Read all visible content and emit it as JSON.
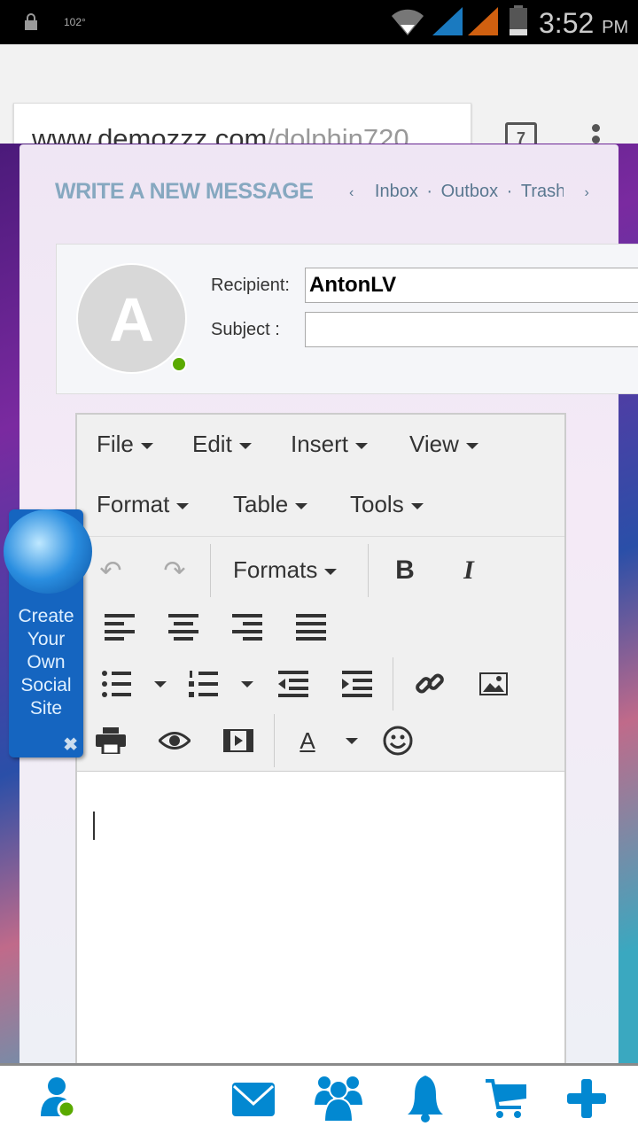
{
  "status_bar": {
    "temperature": "102°",
    "time": "3:52",
    "ampm": "PM",
    "icons": [
      "lock-icon",
      "wifi-icon",
      "signal-icon",
      "signal-icon",
      "battery-icon"
    ],
    "signal_colors": [
      "#1a7ac0",
      "#d06010"
    ]
  },
  "browser": {
    "url_host": "www.demozzz.com",
    "url_path": "/dolphin720",
    "tab_count": "7"
  },
  "page": {
    "title": "WRITE A NEW MESSAGE",
    "nav": {
      "prev": "‹",
      "next": "›",
      "links": [
        "Inbox",
        "Outbox",
        "Trash"
      ],
      "separator": "·"
    }
  },
  "compose": {
    "avatar_letter": "A",
    "recipient_label": "Recipient:",
    "recipient_value": "AntonLV",
    "subject_label": "Subject :",
    "subject_value": ""
  },
  "editor": {
    "menus": [
      "File",
      "Edit",
      "Insert",
      "View",
      "Format",
      "Table",
      "Tools"
    ],
    "formats_label": "Formats",
    "bold": "B",
    "italic": "I",
    "font_color": "A"
  },
  "widget": {
    "text": "Create Your Own Social Site",
    "close": "✖"
  },
  "bottom_nav": [
    "profile-icon",
    "mail-icon",
    "friends-icon",
    "bell-icon",
    "cart-icon",
    "plus-icon"
  ],
  "colors": {
    "accent": "#0288d1",
    "online": "#5aaa00",
    "title": "#86a8c0"
  }
}
